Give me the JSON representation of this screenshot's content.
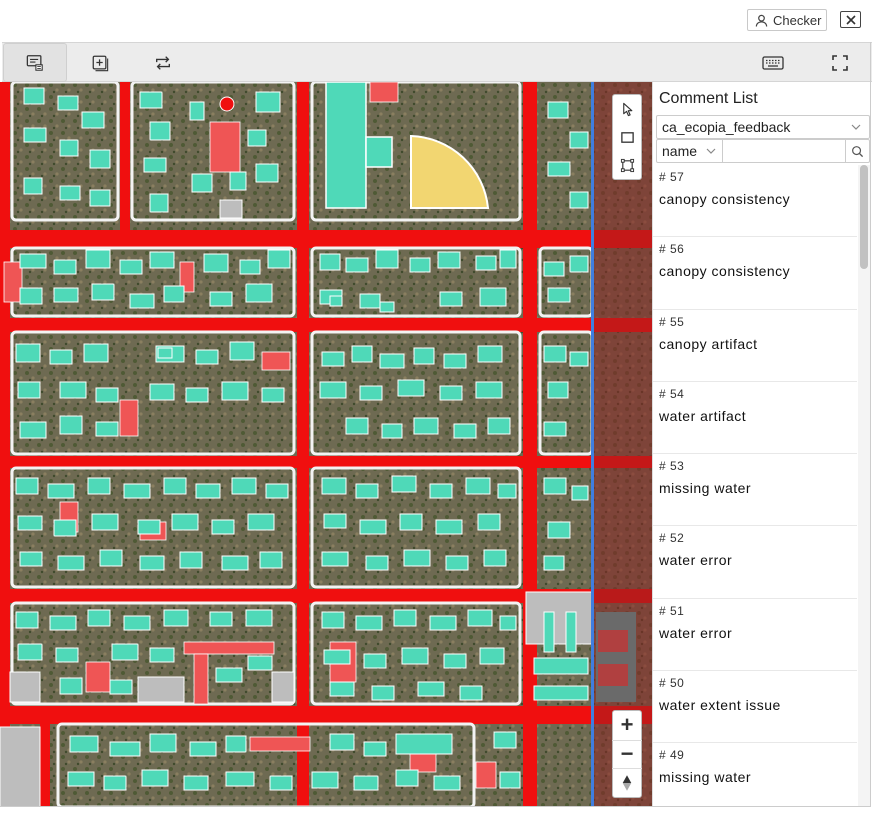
{
  "header": {
    "user_label": "Checker",
    "user_icon": "user-icon",
    "close_icon": "close-icon"
  },
  "toolbar": {
    "buttons": [
      "comment-list-icon",
      "add-layer-icon",
      "swap-icon"
    ],
    "right_buttons": [
      "keyboard-icon",
      "fullscreen-icon"
    ]
  },
  "map_tools": {
    "tools": [
      "select-pointer-icon",
      "rectangle-icon",
      "polygon-select-icon"
    ],
    "zoom_in": "+",
    "zoom_out": "−"
  },
  "panel": {
    "title": "Comment List",
    "dataset": "ca_ecopia_feedback",
    "filter_field": "name",
    "filter_placeholder": "",
    "comments": [
      {
        "num": "# 57",
        "text": "canopy consistency"
      },
      {
        "num": "# 56",
        "text": "canopy consistency"
      },
      {
        "num": "# 55",
        "text": "canopy artifact"
      },
      {
        "num": "# 54",
        "text": "water artifact"
      },
      {
        "num": "# 53",
        "text": "missing water"
      },
      {
        "num": "# 52",
        "text": "water error"
      },
      {
        "num": "# 51",
        "text": "water error"
      },
      {
        "num": "# 50",
        "text": "water extent issue"
      },
      {
        "num": "# 49",
        "text": "missing water"
      }
    ]
  },
  "colors": {
    "road": "#f00f0f",
    "building": "#4fd9b8",
    "red_building": "#ef5555",
    "yellow_feature": "#f2d671",
    "gray_feature": "#bdbdbd",
    "swipe_line": "#3f7ee0"
  }
}
